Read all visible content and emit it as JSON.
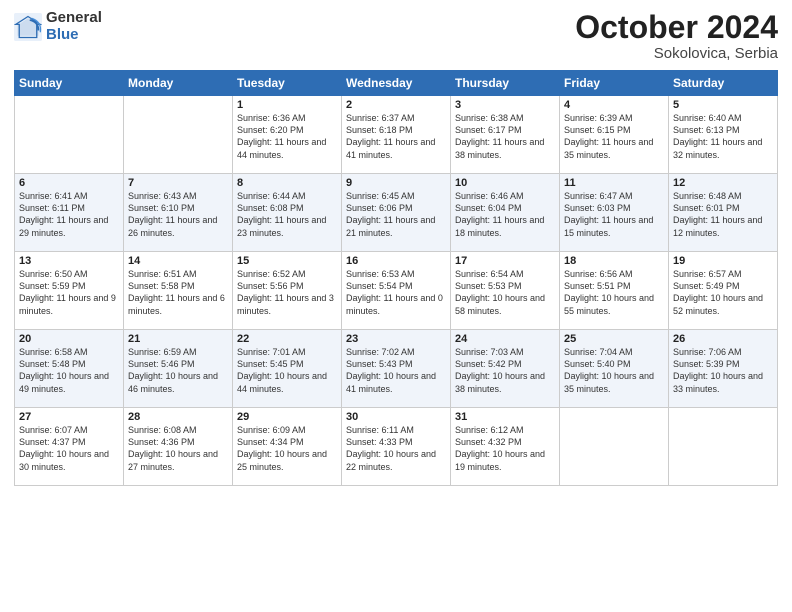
{
  "header": {
    "logo": {
      "general": "General",
      "blue": "Blue"
    },
    "title": "October 2024",
    "location": "Sokolovica, Serbia"
  },
  "weekdays": [
    "Sunday",
    "Monday",
    "Tuesday",
    "Wednesday",
    "Thursday",
    "Friday",
    "Saturday"
  ],
  "weeks": [
    [
      {
        "day": "",
        "sunrise": "",
        "sunset": "",
        "daylight": ""
      },
      {
        "day": "",
        "sunrise": "",
        "sunset": "",
        "daylight": ""
      },
      {
        "day": "1",
        "sunrise": "Sunrise: 6:36 AM",
        "sunset": "Sunset: 6:20 PM",
        "daylight": "Daylight: 11 hours and 44 minutes."
      },
      {
        "day": "2",
        "sunrise": "Sunrise: 6:37 AM",
        "sunset": "Sunset: 6:18 PM",
        "daylight": "Daylight: 11 hours and 41 minutes."
      },
      {
        "day": "3",
        "sunrise": "Sunrise: 6:38 AM",
        "sunset": "Sunset: 6:17 PM",
        "daylight": "Daylight: 11 hours and 38 minutes."
      },
      {
        "day": "4",
        "sunrise": "Sunrise: 6:39 AM",
        "sunset": "Sunset: 6:15 PM",
        "daylight": "Daylight: 11 hours and 35 minutes."
      },
      {
        "day": "5",
        "sunrise": "Sunrise: 6:40 AM",
        "sunset": "Sunset: 6:13 PM",
        "daylight": "Daylight: 11 hours and 32 minutes."
      }
    ],
    [
      {
        "day": "6",
        "sunrise": "Sunrise: 6:41 AM",
        "sunset": "Sunset: 6:11 PM",
        "daylight": "Daylight: 11 hours and 29 minutes."
      },
      {
        "day": "7",
        "sunrise": "Sunrise: 6:43 AM",
        "sunset": "Sunset: 6:10 PM",
        "daylight": "Daylight: 11 hours and 26 minutes."
      },
      {
        "day": "8",
        "sunrise": "Sunrise: 6:44 AM",
        "sunset": "Sunset: 6:08 PM",
        "daylight": "Daylight: 11 hours and 23 minutes."
      },
      {
        "day": "9",
        "sunrise": "Sunrise: 6:45 AM",
        "sunset": "Sunset: 6:06 PM",
        "daylight": "Daylight: 11 hours and 21 minutes."
      },
      {
        "day": "10",
        "sunrise": "Sunrise: 6:46 AM",
        "sunset": "Sunset: 6:04 PM",
        "daylight": "Daylight: 11 hours and 18 minutes."
      },
      {
        "day": "11",
        "sunrise": "Sunrise: 6:47 AM",
        "sunset": "Sunset: 6:03 PM",
        "daylight": "Daylight: 11 hours and 15 minutes."
      },
      {
        "day": "12",
        "sunrise": "Sunrise: 6:48 AM",
        "sunset": "Sunset: 6:01 PM",
        "daylight": "Daylight: 11 hours and 12 minutes."
      }
    ],
    [
      {
        "day": "13",
        "sunrise": "Sunrise: 6:50 AM",
        "sunset": "Sunset: 5:59 PM",
        "daylight": "Daylight: 11 hours and 9 minutes."
      },
      {
        "day": "14",
        "sunrise": "Sunrise: 6:51 AM",
        "sunset": "Sunset: 5:58 PM",
        "daylight": "Daylight: 11 hours and 6 minutes."
      },
      {
        "day": "15",
        "sunrise": "Sunrise: 6:52 AM",
        "sunset": "Sunset: 5:56 PM",
        "daylight": "Daylight: 11 hours and 3 minutes."
      },
      {
        "day": "16",
        "sunrise": "Sunrise: 6:53 AM",
        "sunset": "Sunset: 5:54 PM",
        "daylight": "Daylight: 11 hours and 0 minutes."
      },
      {
        "day": "17",
        "sunrise": "Sunrise: 6:54 AM",
        "sunset": "Sunset: 5:53 PM",
        "daylight": "Daylight: 10 hours and 58 minutes."
      },
      {
        "day": "18",
        "sunrise": "Sunrise: 6:56 AM",
        "sunset": "Sunset: 5:51 PM",
        "daylight": "Daylight: 10 hours and 55 minutes."
      },
      {
        "day": "19",
        "sunrise": "Sunrise: 6:57 AM",
        "sunset": "Sunset: 5:49 PM",
        "daylight": "Daylight: 10 hours and 52 minutes."
      }
    ],
    [
      {
        "day": "20",
        "sunrise": "Sunrise: 6:58 AM",
        "sunset": "Sunset: 5:48 PM",
        "daylight": "Daylight: 10 hours and 49 minutes."
      },
      {
        "day": "21",
        "sunrise": "Sunrise: 6:59 AM",
        "sunset": "Sunset: 5:46 PM",
        "daylight": "Daylight: 10 hours and 46 minutes."
      },
      {
        "day": "22",
        "sunrise": "Sunrise: 7:01 AM",
        "sunset": "Sunset: 5:45 PM",
        "daylight": "Daylight: 10 hours and 44 minutes."
      },
      {
        "day": "23",
        "sunrise": "Sunrise: 7:02 AM",
        "sunset": "Sunset: 5:43 PM",
        "daylight": "Daylight: 10 hours and 41 minutes."
      },
      {
        "day": "24",
        "sunrise": "Sunrise: 7:03 AM",
        "sunset": "Sunset: 5:42 PM",
        "daylight": "Daylight: 10 hours and 38 minutes."
      },
      {
        "day": "25",
        "sunrise": "Sunrise: 7:04 AM",
        "sunset": "Sunset: 5:40 PM",
        "daylight": "Daylight: 10 hours and 35 minutes."
      },
      {
        "day": "26",
        "sunrise": "Sunrise: 7:06 AM",
        "sunset": "Sunset: 5:39 PM",
        "daylight": "Daylight: 10 hours and 33 minutes."
      }
    ],
    [
      {
        "day": "27",
        "sunrise": "Sunrise: 6:07 AM",
        "sunset": "Sunset: 4:37 PM",
        "daylight": "Daylight: 10 hours and 30 minutes."
      },
      {
        "day": "28",
        "sunrise": "Sunrise: 6:08 AM",
        "sunset": "Sunset: 4:36 PM",
        "daylight": "Daylight: 10 hours and 27 minutes."
      },
      {
        "day": "29",
        "sunrise": "Sunrise: 6:09 AM",
        "sunset": "Sunset: 4:34 PM",
        "daylight": "Daylight: 10 hours and 25 minutes."
      },
      {
        "day": "30",
        "sunrise": "Sunrise: 6:11 AM",
        "sunset": "Sunset: 4:33 PM",
        "daylight": "Daylight: 10 hours and 22 minutes."
      },
      {
        "day": "31",
        "sunrise": "Sunrise: 6:12 AM",
        "sunset": "Sunset: 4:32 PM",
        "daylight": "Daylight: 10 hours and 19 minutes."
      },
      {
        "day": "",
        "sunrise": "",
        "sunset": "",
        "daylight": ""
      },
      {
        "day": "",
        "sunrise": "",
        "sunset": "",
        "daylight": ""
      }
    ]
  ]
}
